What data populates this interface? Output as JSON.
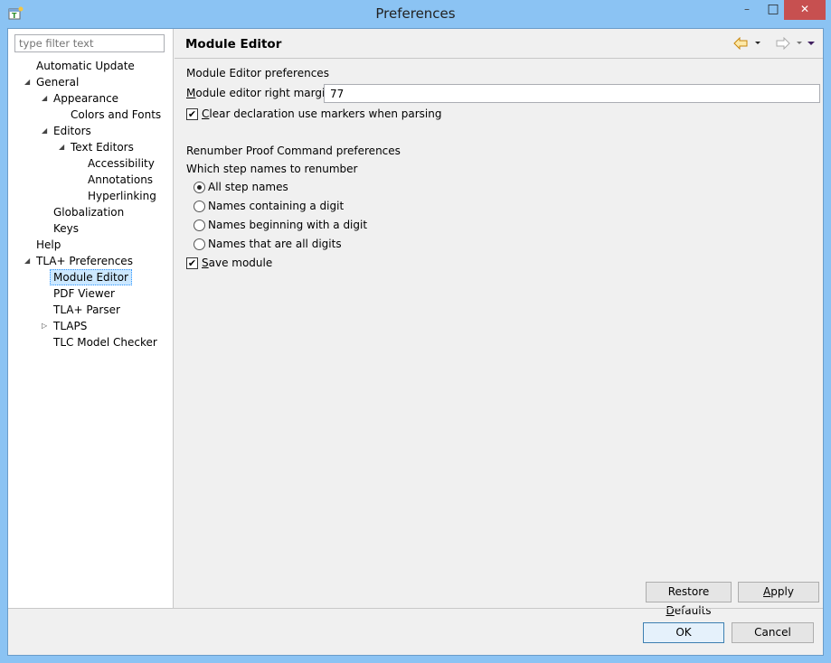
{
  "window": {
    "title": "Preferences",
    "minimize": "–",
    "maximize": "□",
    "close": "✕"
  },
  "filter": {
    "placeholder": "type filter text"
  },
  "tree": [
    {
      "label": "Automatic Update",
      "level": 0,
      "expander": ""
    },
    {
      "label": "General",
      "level": 0,
      "expander": "expanded"
    },
    {
      "label": "Appearance",
      "level": 1,
      "expander": "expanded"
    },
    {
      "label": "Colors and Fonts",
      "level": 2,
      "expander": ""
    },
    {
      "label": "Editors",
      "level": 1,
      "expander": "expanded"
    },
    {
      "label": "Text Editors",
      "level": 2,
      "expander": "expanded"
    },
    {
      "label": "Accessibility",
      "level": 3,
      "expander": ""
    },
    {
      "label": "Annotations",
      "level": 3,
      "expander": ""
    },
    {
      "label": "Hyperlinking",
      "level": 3,
      "expander": ""
    },
    {
      "label": "Globalization",
      "level": 1,
      "expander": ""
    },
    {
      "label": "Keys",
      "level": 1,
      "expander": ""
    },
    {
      "label": "Help",
      "level": 0,
      "expander": ""
    },
    {
      "label": "TLA+ Preferences",
      "level": 0,
      "expander": "expanded"
    },
    {
      "label": "Module Editor",
      "level": 1,
      "expander": "",
      "selected": true
    },
    {
      "label": "PDF Viewer",
      "level": 1,
      "expander": ""
    },
    {
      "label": "TLA+ Parser",
      "level": 1,
      "expander": ""
    },
    {
      "label": "TLAPS",
      "level": 1,
      "expander": "collapsed"
    },
    {
      "label": "TLC Model Checker",
      "level": 1,
      "expander": ""
    }
  ],
  "page": {
    "title": "Module Editor",
    "section1": "Module Editor preferences",
    "margin_label_u": "M",
    "margin_label_rest": "odule editor right margin",
    "margin_value": "77",
    "clear_markers_u": "C",
    "clear_markers_rest": "lear declaration use markers when parsing",
    "clear_markers_checked": true,
    "section2": "Renumber Proof Command preferences",
    "which_label": "Which step names to renumber",
    "radios": [
      {
        "label": "All step names",
        "checked": true
      },
      {
        "label": "Names containing  a digit",
        "checked": false
      },
      {
        "label": "Names beginning with a digit",
        "checked": false
      },
      {
        "label": "Names that are all digits",
        "checked": false
      }
    ],
    "save_u": "S",
    "save_rest": "ave module",
    "save_checked": true,
    "restore_a": "Restore ",
    "restore_u": "D",
    "restore_b": "efaults",
    "apply_u": "A",
    "apply_rest": "pply"
  },
  "footer": {
    "ok": "OK",
    "cancel": "Cancel"
  },
  "colors": {
    "titlebar": "#8bc3f3",
    "close": "#c75050",
    "back_arrow": "#e8a317"
  }
}
